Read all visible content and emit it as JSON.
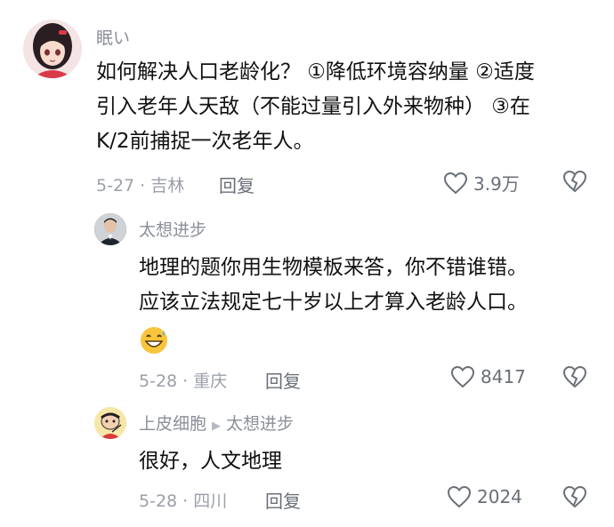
{
  "comments": [
    {
      "username": "眠い",
      "lines": [
        "如何解决人口老龄化？ ①降低环境容纳量 ②适度",
        "引入老年人天敌（不能过量引入外来物种） ③在",
        "K/2前捕捉一次老年人。"
      ],
      "date_location": "5-27 · 吉林",
      "reply_label": "回复",
      "likes": "3.9万",
      "avatar_icon": "anime-girl-avatar"
    },
    {
      "username": "太想进步",
      "lines": [
        "地理的题你用生物模板来答，你不错谁错。",
        "应该立法规定七十岁以上才算入老龄人口。"
      ],
      "emoji_icon": "grinning-sweat-emoji",
      "date_location": "5-28 · 重庆",
      "reply_label": "回复",
      "likes": "8417",
      "avatar_icon": "man-in-suit-avatar"
    },
    {
      "username": "上皮细胞",
      "reply_to": "太想进步",
      "lines": [
        "很好，人文地理"
      ],
      "date_location": "5-28 · 四川",
      "reply_label": "回复",
      "likes": "2024",
      "avatar_icon": "cartoon-kid-avatar"
    }
  ],
  "icons": {
    "like": "heart-outline-icon",
    "dislike": "broken-heart-icon"
  }
}
